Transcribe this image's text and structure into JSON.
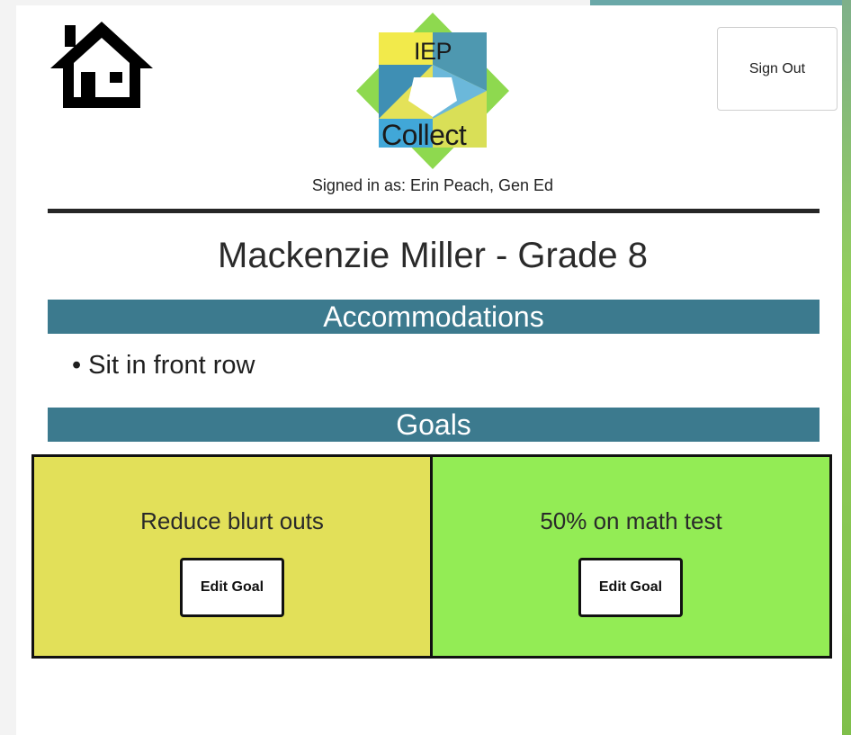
{
  "header": {
    "sign_out_label": "Sign Out",
    "signed_in_text": "Signed in as: Erin Peach, Gen Ed",
    "logo": {
      "top_word": "IEP",
      "bottom_word": "Collect"
    }
  },
  "student": {
    "title": "Mackenzie Miller - Grade 8"
  },
  "accommodations": {
    "heading": "Accommodations",
    "items": [
      "Sit in front row"
    ]
  },
  "goals": {
    "heading": "Goals",
    "items": [
      {
        "title": "Reduce blurt outs",
        "button_label": "Edit Goal",
        "color": "#e2e059"
      },
      {
        "title": "50% on math test",
        "button_label": "Edit Goal",
        "color": "#93ec55"
      }
    ]
  },
  "colors": {
    "section_header": "#3c7a8e",
    "divider": "#262626"
  }
}
